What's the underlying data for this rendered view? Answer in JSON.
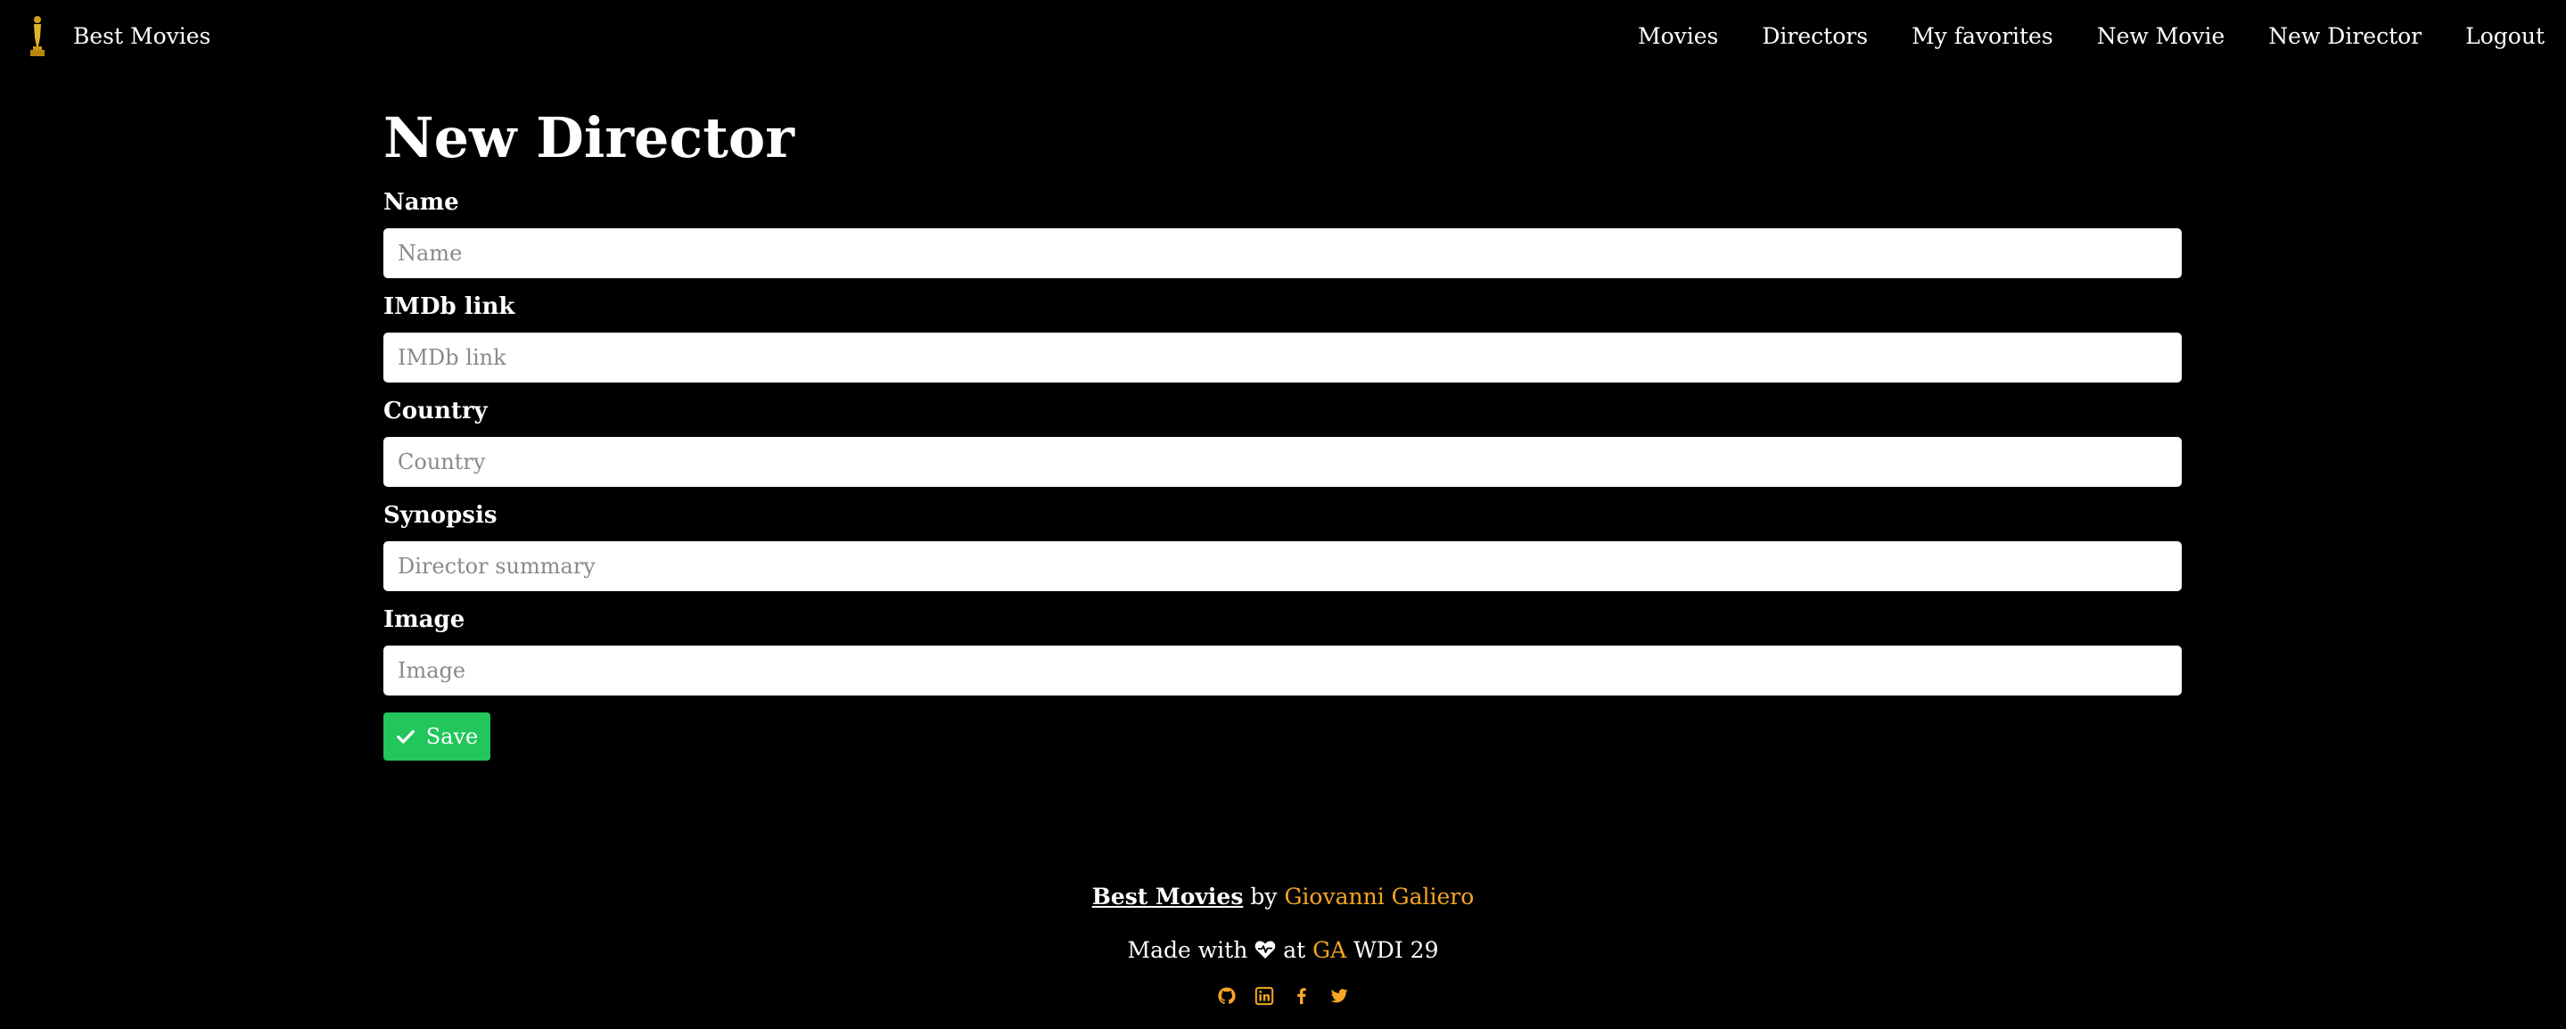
{
  "brand": {
    "name": "Best Movies",
    "logo_icon": "oscar-statuette-icon"
  },
  "nav": {
    "items": [
      {
        "label": "Movies"
      },
      {
        "label": "Directors"
      },
      {
        "label": "My favorites"
      },
      {
        "label": "New Movie"
      },
      {
        "label": "New Director"
      },
      {
        "label": "Logout"
      }
    ]
  },
  "form": {
    "title": "New Director",
    "fields": [
      {
        "label": "Name",
        "placeholder": "Name",
        "value": ""
      },
      {
        "label": "IMDb link",
        "placeholder": "IMDb link",
        "value": ""
      },
      {
        "label": "Country",
        "placeholder": "Country",
        "value": ""
      },
      {
        "label": "Synopsis",
        "placeholder": "Director summary",
        "value": ""
      },
      {
        "label": "Image",
        "placeholder": "Image",
        "value": ""
      }
    ],
    "save_label": "Save",
    "save_icon": "check-icon",
    "save_color": "#22c65b"
  },
  "footer": {
    "app_name": "Best Movies",
    "by_text": "by",
    "author": "Giovanni Galiero",
    "made_with": "Made with",
    "heart_icon": "heart-icon",
    "at_text": "at",
    "school": "GA",
    "course": "WDI 29",
    "accent_color": "#f5a623",
    "social_icons": [
      "github-icon",
      "linkedin-icon",
      "facebook-icon",
      "twitter-icon"
    ]
  }
}
